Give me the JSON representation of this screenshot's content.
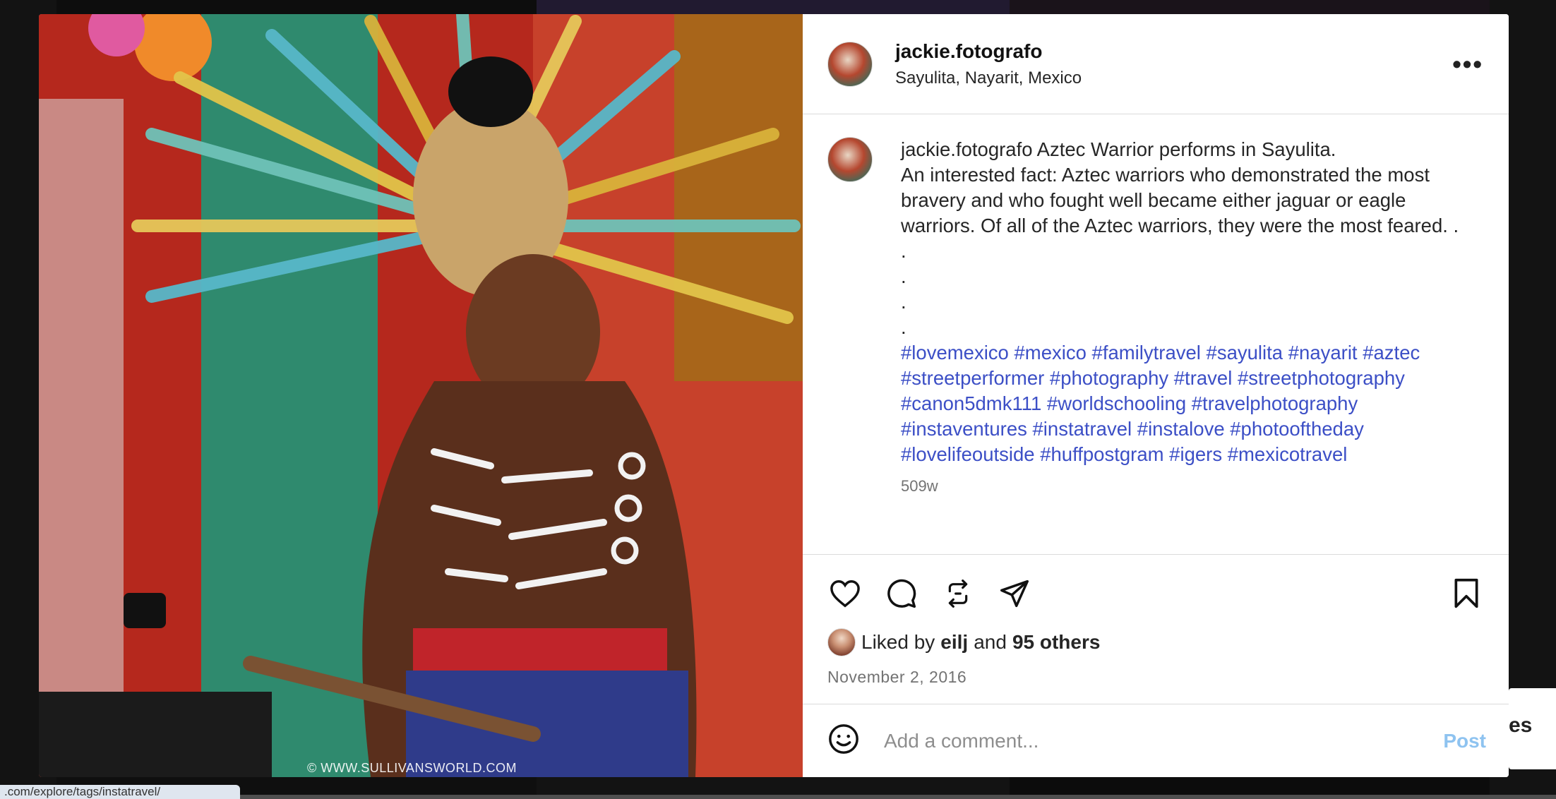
{
  "post": {
    "username": "jackie.fotografo",
    "location": "Sayulita, Nayarit, Mexico",
    "more_label": "•••",
    "photo_watermark": "© WWW.SULLIVANSWORLD.COM",
    "caption_user": "jackie.fotografo",
    "caption_text": " Aztec Warrior performs in Sayulita.\nAn interested fact: Aztec warriors who demonstrated the most bravery and who fought well became either jaguar or eagle warriors. Of all of the Aztec warriors, they were the most feared. .\n.\n.\n.\n.",
    "hashtags": [
      "#lovemexico",
      "#mexico",
      "#familytravel",
      "#sayulita",
      "#nayarit",
      "#aztec",
      "#streetperformer",
      "#photography",
      "#travel",
      "#streetphotography",
      "#canon5dmk111",
      "#worldschooling",
      "#travelphotography",
      "#instaventures",
      "#instatravel",
      "#instalove",
      "#photooftheday",
      "#lovelifeoutside",
      "#huffpostgram",
      "#igers",
      "#mexicotravel"
    ],
    "caption_age": "509w",
    "likes": {
      "prefix": "Liked by",
      "liker": "eilj",
      "and": "and",
      "others": "95 others"
    },
    "date": "November 2, 2016",
    "comment_placeholder": "Add a comment...",
    "post_button": "Post"
  },
  "icons": {
    "like": "heart-icon",
    "comment": "comment-icon",
    "repost": "repost-icon",
    "share": "send-icon",
    "save": "bookmark-icon",
    "emoji": "emoji-icon"
  },
  "status_bar_url": ".com/explore/tags/instatravel/",
  "side_peek_text": "es",
  "colors": {
    "hashtag": "#3c4fc6",
    "post_button": "#8ec3f0",
    "secondary_text": "#737373"
  }
}
